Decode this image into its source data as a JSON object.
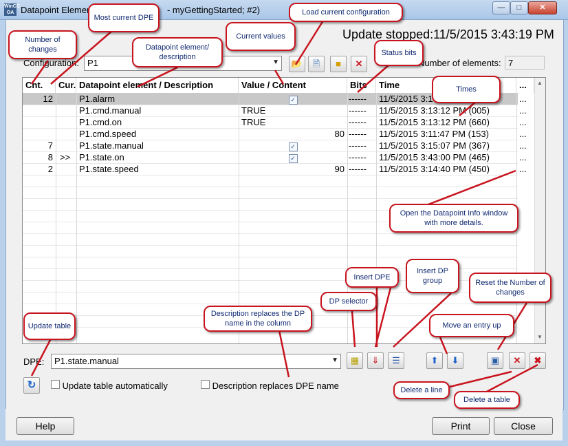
{
  "window": {
    "title": "Datapoint Element",
    "title_suffix": "- myGettingStarted; #2)",
    "icon_text": "WinCC OA",
    "status": "Update stopped:11/5/2015 3:43:19 PM"
  },
  "config": {
    "label": "Configuration:",
    "value": "P1",
    "num_label": "Number of elements:",
    "num_value": "7"
  },
  "table": {
    "columns": [
      "Cnt.",
      "Cur.",
      "Datapoint element / Description",
      "Value / Content",
      "Bits",
      "Time",
      "..."
    ],
    "rows": [
      {
        "cnt": "12",
        "cur": "",
        "dpe": "P1.alarm",
        "value": "",
        "check": true,
        "bits": "------",
        "time": "11/5/2015 3:1",
        "more": "..."
      },
      {
        "cnt": "",
        "cur": "",
        "dpe": "P1.cmd.manual",
        "value": "TRUE",
        "check": false,
        "bits": "------",
        "time": "11/5/2015 3:13:12 PM  (005)",
        "more": "..."
      },
      {
        "cnt": "",
        "cur": "",
        "dpe": "P1.cmd.on",
        "value": "TRUE",
        "check": false,
        "bits": "------",
        "time": "11/5/2015 3:13:12 PM  (660)",
        "more": "..."
      },
      {
        "cnt": "",
        "cur": "",
        "dpe": "P1.cmd.speed",
        "value": "80",
        "check": false,
        "bits": "------",
        "time": "11/5/2015 3:11:47 PM  (153)",
        "more": "..."
      },
      {
        "cnt": "7",
        "cur": "",
        "dpe": "P1.state.manual",
        "value": "",
        "check": true,
        "bits": "------",
        "time": "11/5/2015 3:15:07 PM  (367)",
        "more": "..."
      },
      {
        "cnt": "8",
        "cur": ">>",
        "dpe": "P1.state.on",
        "value": "",
        "check": true,
        "bits": "------",
        "time": "11/5/2015 3:43:00 PM  (465)",
        "more": "..."
      },
      {
        "cnt": "2",
        "cur": "",
        "dpe": "P1.state.speed",
        "value": "90",
        "check": false,
        "bits": "------",
        "time": "11/5/2015 3:14:40 PM  (450)",
        "more": "..."
      }
    ]
  },
  "dpe": {
    "label": "DPE:",
    "value": "P1.state.manual"
  },
  "options": {
    "auto_update": "Update table automatically",
    "desc_replaces": "Description replaces DPE name"
  },
  "buttons": {
    "help": "Help",
    "print": "Print",
    "close": "Close"
  },
  "callouts": {
    "num_changes": "Number of changes",
    "most_current": "Most current DPE",
    "dpe_desc": "Datapoint element/ description",
    "current_values": "Current values",
    "load_config": "Load current configuration",
    "status_bits": "Status bits",
    "times": "Times",
    "open_info": "Open the Datapoint Info window with more details.",
    "insert_dpe": "Insert DPE",
    "insert_group": "Insert DP group",
    "reset_changes": "Reset the Number of changes",
    "dp_selector": "DP selector",
    "desc_column": "Description replaces the DP name in the column",
    "update_table": "Update table",
    "move_up": "Move an entry up",
    "delete_line": "Delete a line",
    "delete_table": "Delete a table"
  },
  "colors": {
    "callout_border": "#c8141e",
    "callout_text": "#102a70",
    "selected_row": "#c8c8c8"
  }
}
